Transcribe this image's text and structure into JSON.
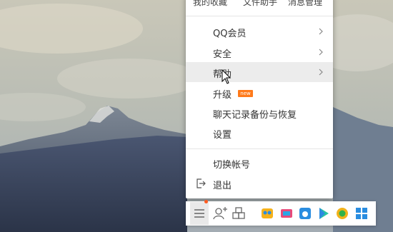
{
  "menu": {
    "top_items": [
      "我的收藏",
      "文件助手",
      "消息管理"
    ],
    "items": [
      {
        "label": "QQ会员",
        "has_submenu": true
      },
      {
        "label": "安全",
        "has_submenu": true
      },
      {
        "label": "帮助",
        "has_submenu": true,
        "highlighted": true
      },
      {
        "label": "升级",
        "badge": "new"
      },
      {
        "label": "聊天记录备份与恢复"
      },
      {
        "label": "设置"
      },
      {
        "label": "切换帐号"
      },
      {
        "label": "退出"
      }
    ]
  },
  "taskbar": {
    "icons": [
      "menu-icon",
      "add-contact-icon",
      "app-manager-icon",
      "cloud-app-icon",
      "screen-app-icon",
      "weiyun-icon",
      "play-icon",
      "browser-icon",
      "apps-grid-icon"
    ]
  },
  "colors": {
    "menu_bg": "#ffffff",
    "highlight": "#ececec",
    "badge": "#ff7a1a",
    "notify_dot": "#ff5a1f"
  }
}
